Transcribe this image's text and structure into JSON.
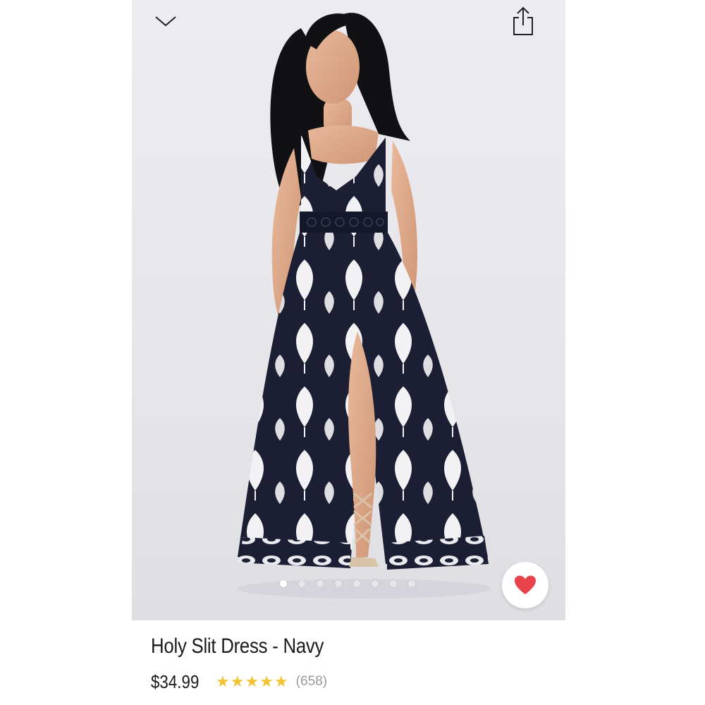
{
  "product": {
    "title": "Holy Slit Dress - Navy",
    "price": "$34.99",
    "rating": 5,
    "review_count": "(658)"
  },
  "gallery": {
    "image_count": 8,
    "active_index": 0
  },
  "icons": {
    "collapse": "chevron-down-icon",
    "share": "share-icon",
    "favorite": "heart-icon"
  },
  "colors": {
    "heart": "#e8434a",
    "stars": "#f2c232",
    "dress": "#1c1e33",
    "reviews": "#9a9a9a"
  }
}
